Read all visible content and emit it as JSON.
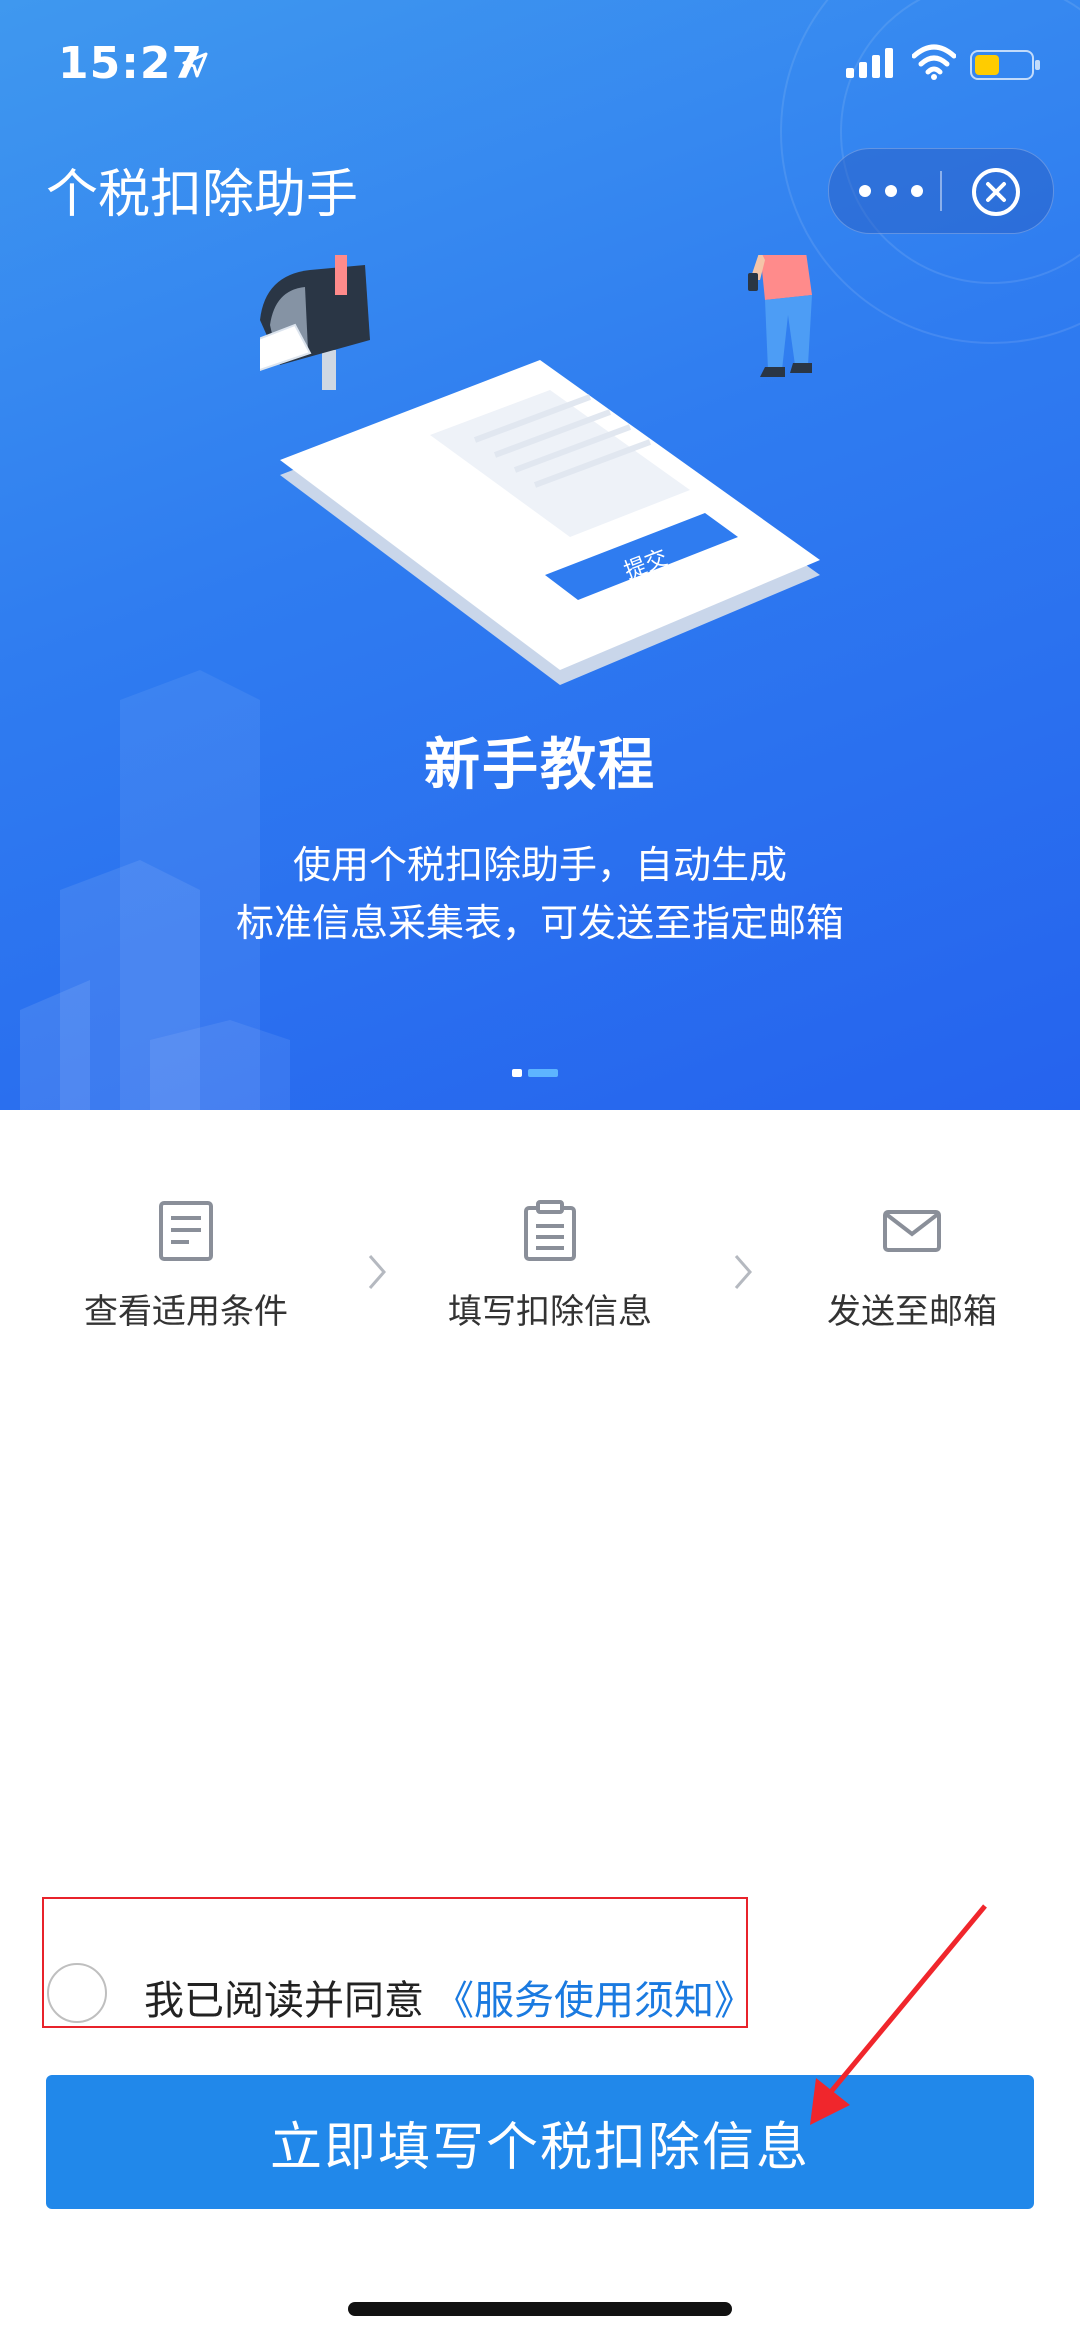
{
  "status_bar": {
    "time": "15:27"
  },
  "nav": {
    "title": "个税扣除助手"
  },
  "hero": {
    "title": "新手教程",
    "desc_line1": "使用个税扣除助手，自动生成",
    "desc_line2": "标准信息采集表，可发送至指定邮箱",
    "illustration_mail_label": "mail",
    "illustration_button_label": "提交",
    "pager": {
      "current": 1,
      "total": 2
    }
  },
  "steps": [
    {
      "label": "查看适用条件",
      "icon": "document-icon"
    },
    {
      "label": "填写扣除信息",
      "icon": "clipboard-icon"
    },
    {
      "label": "发送至邮箱",
      "icon": "envelope-icon"
    }
  ],
  "agreement": {
    "text": "我已阅读并同意",
    "link": "《服务使用须知》",
    "checked": false
  },
  "primary_button": {
    "label": "立即填写个税扣除信息"
  },
  "colors": {
    "hero_start": "#3f98ef",
    "hero_end": "#2563ee",
    "primary": "#2188ea",
    "link": "#1a7ae0",
    "highlight": "#e8232b"
  }
}
